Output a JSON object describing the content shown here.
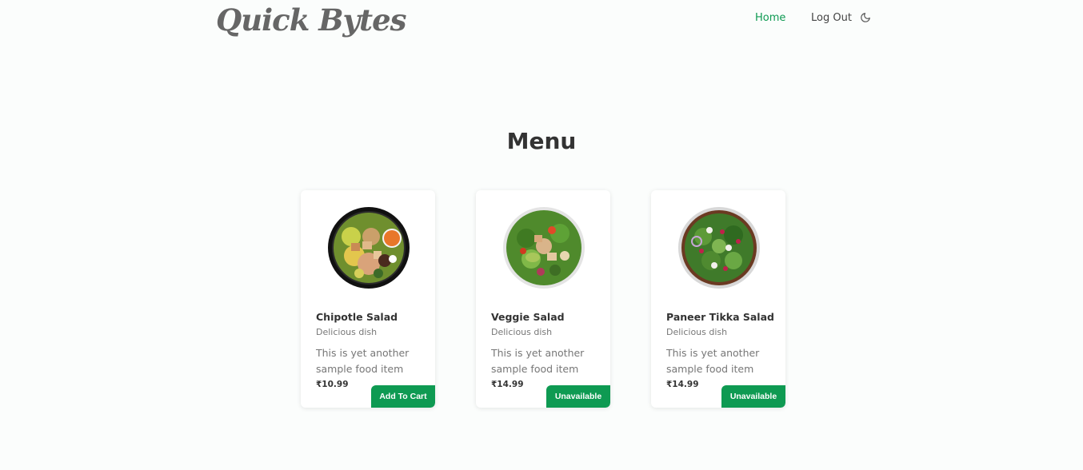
{
  "brand": {
    "logo_text": "Quick Bytes"
  },
  "nav": {
    "home_label": "Home",
    "logout_label": "Log Out",
    "theme_icon": "moon-icon"
  },
  "menu": {
    "title": "Menu",
    "items": [
      {
        "name": "Chipotle Salad",
        "tag": "Delicious dish",
        "description": "This is yet another sample food item",
        "price": "₹10.99",
        "button_label": "Add To Cart",
        "available": true
      },
      {
        "name": "Veggie Salad",
        "tag": "Delicious dish",
        "description": "This is yet another sample food item",
        "price": "₹14.99",
        "button_label": "Unavailable",
        "available": false
      },
      {
        "name": "Paneer Tikka Salad",
        "tag": "Delicious dish",
        "description": "This is yet another sample food item",
        "price": "₹14.99",
        "button_label": "Unavailable",
        "available": false
      }
    ]
  },
  "colors": {
    "accent": "#0e9a52",
    "background": "#fbfdfc",
    "text_dark": "#333333",
    "text_muted": "#777777"
  }
}
